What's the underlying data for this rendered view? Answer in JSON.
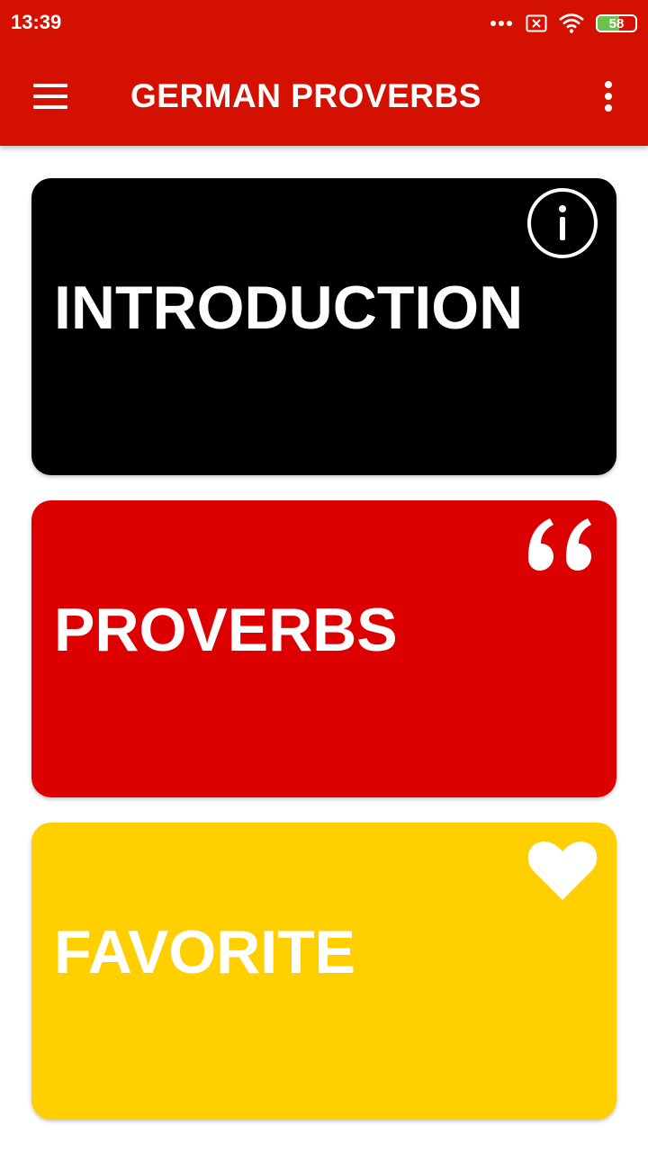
{
  "status_bar": {
    "time": "13:39",
    "battery_level": "58",
    "battery_percent": 58,
    "icons": [
      "more-dots-icon",
      "sim-error-icon",
      "wifi-icon",
      "battery-icon"
    ]
  },
  "app_bar": {
    "title": "GERMAN PROVERBS",
    "menu_icon": "hamburger-menu-icon",
    "overflow_icon": "overflow-menu-icon"
  },
  "cards": {
    "introduction": {
      "label": "INTRODUCTION",
      "icon": "info-icon",
      "color": "#000000"
    },
    "proverbs": {
      "label": "PROVERBS",
      "icon": "quote-icon",
      "color": "#dd0000"
    },
    "favorite": {
      "label": "FAVORITE",
      "icon": "heart-icon",
      "color": "#ffcf00"
    }
  },
  "colors": {
    "app_bar": "#d41000",
    "text_on_card": "#ffffff"
  }
}
